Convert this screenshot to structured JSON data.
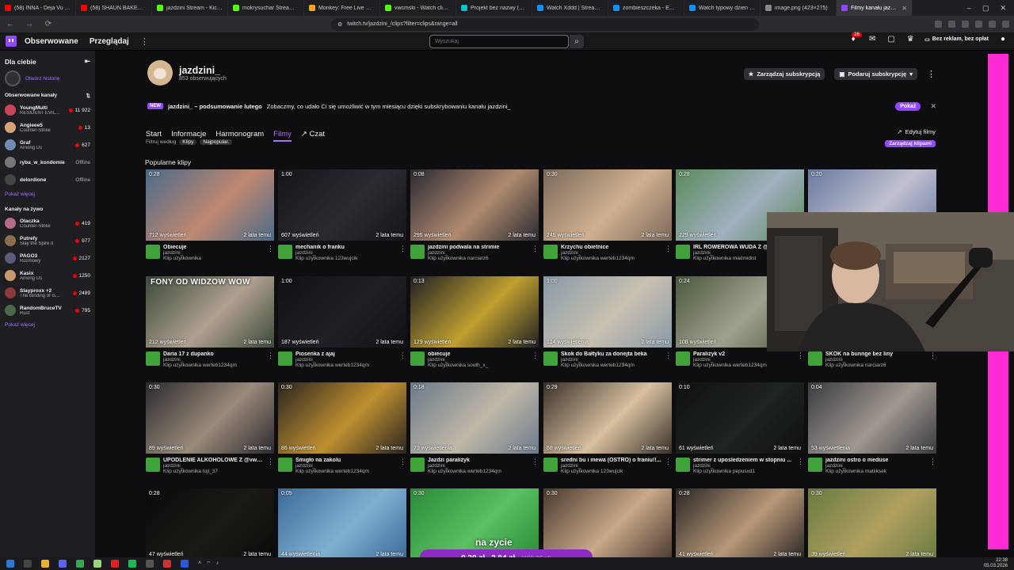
{
  "browser": {
    "tabs": [
      {
        "title": "(58) INNA - Deja Vu (fe",
        "color": "#ff0000"
      },
      {
        "title": "(58) SHAUN BAKER feat. Ar",
        "color": "#ff0000"
      },
      {
        "title": "jazdzini Stream - Kick Dash",
        "color": "#53fc18"
      },
      {
        "title": "mokrysuchar Stream - Wat",
        "color": "#53fc18"
      },
      {
        "title": "Monkey: Free Live Video C",
        "color": "#f5a623"
      },
      {
        "title": "vwcmski - Watch clips on K",
        "color": "#53fc18"
      },
      {
        "title": "Projekt bez nazwy (1) - Em",
        "color": "#00c4cc"
      },
      {
        "title": "Watch Xddd | Streamable",
        "color": "#0f90fa"
      },
      {
        "title": "zombieszczeka - Embed",
        "color": "#0f90fa"
      },
      {
        "title": "Watch typowy dzien w mie",
        "color": "#0f90fa"
      },
      {
        "title": "image.png (423×275)",
        "color": "#888888"
      },
      {
        "title": "Filmy kanału jazdzini_",
        "color": "#9147ff"
      }
    ],
    "url": "twitch.tv/jazdzini_/clips?filter=clips&range=all"
  },
  "topnav": {
    "following": "Obserwowane",
    "browse": "Przeglądaj",
    "search_placeholder": "Wyszukaj",
    "notif_count": "26",
    "ad_free": "Bez reklam, bez opłat"
  },
  "sidebar": {
    "for_you": "Dla ciebie",
    "history": "Otwórz historię",
    "followed_header": "Obserwowane kanały",
    "followed": [
      {
        "name": "YoungMulti",
        "game": "RESIDENT EVIL...",
        "viewers": "11 922",
        "color": "#c9455a"
      },
      {
        "name": "Angieee5",
        "game": "Counter-Strike",
        "viewers": "13",
        "color": "#d9a37a"
      },
      {
        "name": "Graf",
        "game": "Among Us",
        "viewers": "627",
        "color": "#6e8bb1"
      },
      {
        "name": "ryba_w_kondomie",
        "game": "",
        "viewers": "Offline",
        "color": "#777777"
      },
      {
        "name": "delordione",
        "game": "",
        "viewers": "Offline",
        "color": "#444444"
      }
    ],
    "show_more_1": "Pokaż więcej",
    "live_header": "Kanały na żywo",
    "live": [
      {
        "name": "Olaczka",
        "game": "Counter-Strike",
        "viewers": "419",
        "color": "#b46a8a"
      },
      {
        "name": "Putrefy",
        "game": "Slay the Spire II",
        "viewers": "977",
        "color": "#8a6e4e"
      },
      {
        "name": "PAGO3",
        "game": "Rozmowy",
        "viewers": "2127",
        "color": "#5a5a7a"
      },
      {
        "name": "Kasix",
        "game": "Among Us",
        "viewers": "1250",
        "color": "#c99a6e"
      },
      {
        "name": "Slayproxx +2",
        "game": "The Binding of Is...",
        "viewers": "2489",
        "color": "#8a3a3a"
      },
      {
        "name": "RandomBruceTV",
        "game": "Rust",
        "viewers": "795",
        "color": "#4a6a4a"
      }
    ],
    "show_more_2": "Pokaż więcej"
  },
  "channel": {
    "name": "jazdzini_",
    "followers": "853 obserwujących",
    "manage_sub": "Zarządzaj subskrypcją",
    "gift_sub": "Podaruj subskrypcję",
    "promo_new": "NEW",
    "promo_title": "jazdzini_ – podsumowanie lutego",
    "promo_desc": "Zobaczmy, co udało Ci się umożliwić w tym miesiącu dzięki subskrybowaniu kanału jazdzini_",
    "promo_show": "Pokaż",
    "tabs": [
      "Start",
      "Informacje",
      "Harmonogram",
      "Filmy",
      "Czat"
    ],
    "edit_videos": "Edytuj filmy",
    "filter_label": "Filtruj według",
    "filter_value": "Klipy",
    "range_value": "Najpopular.",
    "manage_clips": "Zarządzaj klipami",
    "section": "Popularne klipy"
  },
  "clips": [
    {
      "dur": "0:28",
      "views": "712 wyświetleń",
      "age": "2 lata temu",
      "title": "Obiecuje",
      "channel": "jazdzini_",
      "clipper": "Klip użytkownika",
      "bg": "#4a6a8a",
      "bg2": "#c08870",
      "overlay": ""
    },
    {
      "dur": "1:00",
      "views": "607 wyświetleń",
      "age": "2 lata temu",
      "title": "mechanik o franku",
      "channel": "jazdzini_",
      "clipper": "Klip użytkownika 123wujcik",
      "bg": "#15151a",
      "bg2": "#2a2a30",
      "overlay": ""
    },
    {
      "dur": "0:08",
      "views": "295 wyświetleń",
      "age": "2 lata temu",
      "title": "jazdzini podwala na strimie",
      "channel": "jazdzini_",
      "clipper": "Klip użytkownika narciarz6",
      "bg": "#2a2a30",
      "bg2": "#b08a70",
      "overlay": ""
    },
    {
      "dur": "0:30",
      "views": "245 wyświetleń",
      "age": "2 lata temu",
      "title": "Krzychu obietnice",
      "channel": "jazdzini_",
      "clipper": "Klip użytkownika werteb1234qm",
      "bg": "#7a6a5a",
      "bg2": "#d0b090",
      "overlay": ""
    },
    {
      "dur": "0:28",
      "views": "229 wyświetleń",
      "age": "2 lata temu",
      "title": "IRL ROWEROWA WUDA Z @...",
      "channel": "jazdzini_",
      "clipper": "Klip użytkownika madmidist",
      "bg": "#5a8a5a",
      "bg2": "#a0b0c0",
      "overlay": ""
    },
    {
      "dur": "0:20",
      "views": "",
      "age": "",
      "title": "",
      "channel": "",
      "clipper": "",
      "bg": "#6a7aa0",
      "bg2": "#c0c0d0",
      "overlay": ""
    },
    {
      "dur": "",
      "views": "212 wyświetleń",
      "age": "2 lata temu",
      "title": "Daria 17 z dupanko",
      "channel": "jazdzini_",
      "clipper": "Klip użytkownika werteb1234qm",
      "bg": "#3a4a3a",
      "bg2": "#b0a090",
      "overlay": "FONY OD WIDZOW WOW"
    },
    {
      "dur": "1:00",
      "views": "187 wyświetleń",
      "age": "2 lata temu",
      "title": "Piosenka z ajaj",
      "channel": "jazdzini_",
      "clipper": "Klip użytkownika werteb1234qm",
      "bg": "#101014",
      "bg2": "#202026",
      "overlay": ""
    },
    {
      "dur": "0:13",
      "views": "129 wyświetleń",
      "age": "2 lata temu",
      "title": "obiecuje",
      "channel": "jazdzini_",
      "clipper": "Klip użytkownika south_x_",
      "bg": "#202024",
      "bg2": "#c0a030",
      "overlay": ""
    },
    {
      "dur": "1:00",
      "views": "124 wyświetlenia",
      "age": "2 lata temu",
      "title": "Skok do Bałtyku za donejta beka",
      "channel": "jazdzini_",
      "clipper": "Klip użytkownika werteb1234qm",
      "bg": "#8a9aa8",
      "bg2": "#c8c0b0",
      "overlay": ""
    },
    {
      "dur": "0:24",
      "views": "108 wyświetleń",
      "age": "2 lata temu",
      "title": "Paraliżyk v2",
      "channel": "jazdzini_",
      "clipper": "Klip użytkownika werteb1234qm",
      "bg": "#4a5a3a",
      "bg2": "#a0a090",
      "overlay": ""
    },
    {
      "dur": "",
      "views": "",
      "age": "",
      "title": "SKOK na bunnge bez liny",
      "channel": "jazdzini_",
      "clipper": "Klip użytkownika narciarz6",
      "bg": "#3a3a3a",
      "bg2": "#606060",
      "overlay": ""
    },
    {
      "dur": "0:30",
      "views": "89 wyświetleń",
      "age": "2 lata temu",
      "title": "UPODLENIE ALKOHOLOWE Z @vwo...",
      "channel": "jazdzini_",
      "clipper": "Klip użytkownika toji_37",
      "bg": "#2a2a2e",
      "bg2": "#9a8a7a",
      "overlay": ""
    },
    {
      "dur": "0:30",
      "views": "86 wyświetleń",
      "age": "2 lata temu",
      "title": "Śmigło na zakolu",
      "channel": "jazdzini_",
      "clipper": "Klip użytkownika werteb1234qm",
      "bg": "#2a2420",
      "bg2": "#c09030",
      "overlay": ""
    },
    {
      "dur": "0:18",
      "views": "73 wyświetlenia",
      "age": "2 lata temu",
      "title": "Jazdzi paraliżyk",
      "channel": "jazdzini_",
      "clipper": "Klip użytkownika werteb1234qm",
      "bg": "#6a7a8a",
      "bg2": "#c0b8a8",
      "overlay": ""
    },
    {
      "dur": "0:29",
      "views": "68 wyświetleń",
      "age": "2 lata temu",
      "title": "sredni bu i mewa (OSTRO) o franiu!!...",
      "channel": "jazdzini_",
      "clipper": "Klip użytkownika 123wujcik",
      "bg": "#3a3028",
      "bg2": "#d8c0a0",
      "overlay": ""
    },
    {
      "dur": "0:10",
      "views": "61 wyświetleń",
      "age": "2 lata temu",
      "title": "strimer z uposledzeniem w stopniu ...",
      "channel": "jazdzini_",
      "clipper": "Klip użytkownika pepusxd1",
      "bg": "#0e1010",
      "bg2": "#1e2422",
      "overlay": ""
    },
    {
      "dur": "0:04",
      "views": "53 wyświetlenia",
      "age": "2 lata temu",
      "title": "jazdzini ostro o meduse",
      "channel": "jazdzini_",
      "clipper": "Klip użytkownika matiiksek",
      "bg": "#3a3a40",
      "bg2": "#a09890",
      "overlay": ""
    },
    {
      "dur": "0:28",
      "views": "47 wyświetleń",
      "age": "2 lata temu",
      "title": "",
      "channel": "",
      "clipper": "",
      "bg": "#0a0a0a",
      "bg2": "#1a1a14",
      "overlay": ""
    },
    {
      "dur": "0:05",
      "views": "44 wyświetlenia",
      "age": "2 lata temu",
      "title": "",
      "channel": "",
      "clipper": "",
      "bg": "#3a6a9a",
      "bg2": "#80b0d0",
      "overlay": ""
    },
    {
      "dur": "0:30",
      "views": "",
      "age": "",
      "title": "",
      "channel": "",
      "clipper": "",
      "bg": "#2a8a3a",
      "bg2": "#5ac060",
      "overlay": ""
    },
    {
      "dur": "0:30",
      "views": "",
      "age": "",
      "title": "",
      "channel": "",
      "clipper": "",
      "bg": "#4a3a30",
      "bg2": "#c8a888",
      "overlay": ""
    },
    {
      "dur": "0:28",
      "views": "41 wyświetleń",
      "age": "2 lata temu",
      "title": "",
      "channel": "",
      "clipper": "",
      "bg": "#2a2624",
      "bg2": "#b89878",
      "overlay": ""
    },
    {
      "dur": "0:30",
      "views": "39 wyświetleń",
      "age": "2 lata temu",
      "title": "",
      "channel": "",
      "clipper": "",
      "bg": "#6a7a40",
      "bg2": "#b0a060",
      "overlay": ""
    }
  ],
  "overlay": {
    "caption": "na zycie",
    "donation_a": "9,20 zł",
    "donation_b": "2,04 zł",
    "donation_c": "(150,36 zł)"
  },
  "taskbar": {
    "time": "22:38",
    "date": "05.03.2026"
  }
}
